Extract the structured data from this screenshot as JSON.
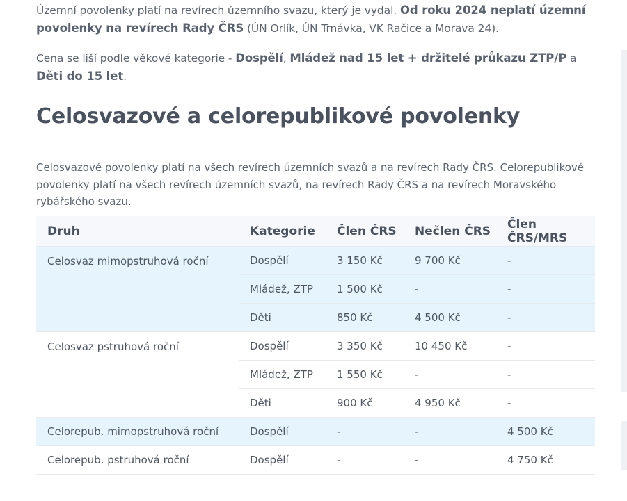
{
  "intro": {
    "p1_text": "Územní povolenky platí na revírech územního svazu, který je vydal. ",
    "p1_bold": "Od roku 2024 neplatí územní povolenky na revírech Rady ČRS",
    "p1_tail": " (ÚN Orlík, ÚN Trnávka, VK Račice a Morava 24).",
    "p2_text": "Cena se liší podle věkové kategorie - ",
    "p2_bold1": "Dospělí",
    "p2_sep1": ", ",
    "p2_bold2": "Mládež nad 15 let + držitelé průkazu ZTP/P",
    "p2_sep2": " a ",
    "p2_bold3": "Děti do 15 let",
    "p2_end": "."
  },
  "section": {
    "heading": "Celosvazové a celorepublikové povolenky",
    "description": "Celosvazové povolenky platí na všech revírech územních svazů a na revírech Rady ČRS. Celorepublikové povolenky platí na všech revírech územních svazů, na revírech Rady ČRS a na revírech Moravského rybářského svazu."
  },
  "table": {
    "headers": [
      "Druh",
      "Kategorie",
      "Člen ČRS",
      "Nečlen ČRS",
      "Člen ČRS/MRS"
    ],
    "groups": [
      {
        "druh": "Celosvaz mimopstruhová roční",
        "rows": [
          [
            "Dospělí",
            "3 150 Kč",
            "9 700 Kč",
            "-"
          ],
          [
            "Mládež, ZTP",
            "1 500 Kč",
            "-",
            "-"
          ],
          [
            "Děti",
            "850 Kč",
            "4 500 Kč",
            "-"
          ]
        ]
      },
      {
        "druh": "Celosvaz pstruhová roční",
        "rows": [
          [
            "Dospělí",
            "3 350 Kč",
            "10 450 Kč",
            "-"
          ],
          [
            "Mládež, ZTP",
            "1 550 Kč",
            "-",
            "-"
          ],
          [
            "Děti",
            "900 Kč",
            "4 950 Kč",
            "-"
          ]
        ]
      },
      {
        "druh": "Celorepub. mimopstruhová roční",
        "rows": [
          [
            "Dospělí",
            "-",
            "-",
            "4 500 Kč"
          ]
        ]
      },
      {
        "druh": "Celorepub. pstruhová roční",
        "rows": [
          [
            "Dospělí",
            "-",
            "-",
            "4 750 Kč"
          ]
        ]
      }
    ]
  },
  "colors": {
    "highlight_row": "#e6f5fd",
    "header_bg": "#f7f8fb",
    "text": "#5c6470"
  }
}
